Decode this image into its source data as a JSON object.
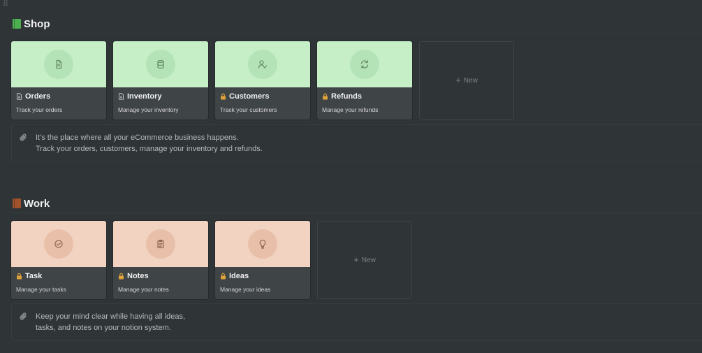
{
  "sections": [
    {
      "title": "Shop",
      "book_color": "#4caf50",
      "cover_color": "#c6efc8",
      "circle_color": "#b3e3b6",
      "icon_stroke": "#6a8f6c",
      "cards": [
        {
          "title": "Orders",
          "description": "Track your orders",
          "icon": "document-icon",
          "title_icon": "page-icon"
        },
        {
          "title": "Inventory",
          "description": "Manage your inventory",
          "icon": "database-icon",
          "title_icon": "page-icon"
        },
        {
          "title": "Customers",
          "description": "Track your customers",
          "icon": "user-check-icon",
          "title_icon": "lock-icon"
        },
        {
          "title": "Refunds",
          "description": "Manage your refunds",
          "icon": "refresh-icon",
          "title_icon": "lock-icon"
        }
      ],
      "new_label": "New",
      "callout": {
        "line1": "It's the place where all your eCommerce business happens.",
        "line2": "Track your orders, customers, manage your inventory and refunds."
      }
    },
    {
      "title": "Work",
      "book_color": "#a0522d",
      "cover_color": "#f2d2c0",
      "circle_color": "#e8c0aa",
      "icon_stroke": "#946a52",
      "cards": [
        {
          "title": "Task",
          "description": "Manage your tasks",
          "icon": "check-circle-icon",
          "title_icon": "lock-icon"
        },
        {
          "title": "Notes",
          "description": "Manage your notes",
          "icon": "clipboard-icon",
          "title_icon": "lock-icon"
        },
        {
          "title": "Ideas",
          "description": "Manage your ideas",
          "icon": "lightbulb-icon",
          "title_icon": "lock-icon"
        }
      ],
      "new_label": "New",
      "callout": {
        "line1": "Keep your mind clear while having all ideas,",
        "line2": "tasks, and notes on your notion system."
      }
    }
  ]
}
